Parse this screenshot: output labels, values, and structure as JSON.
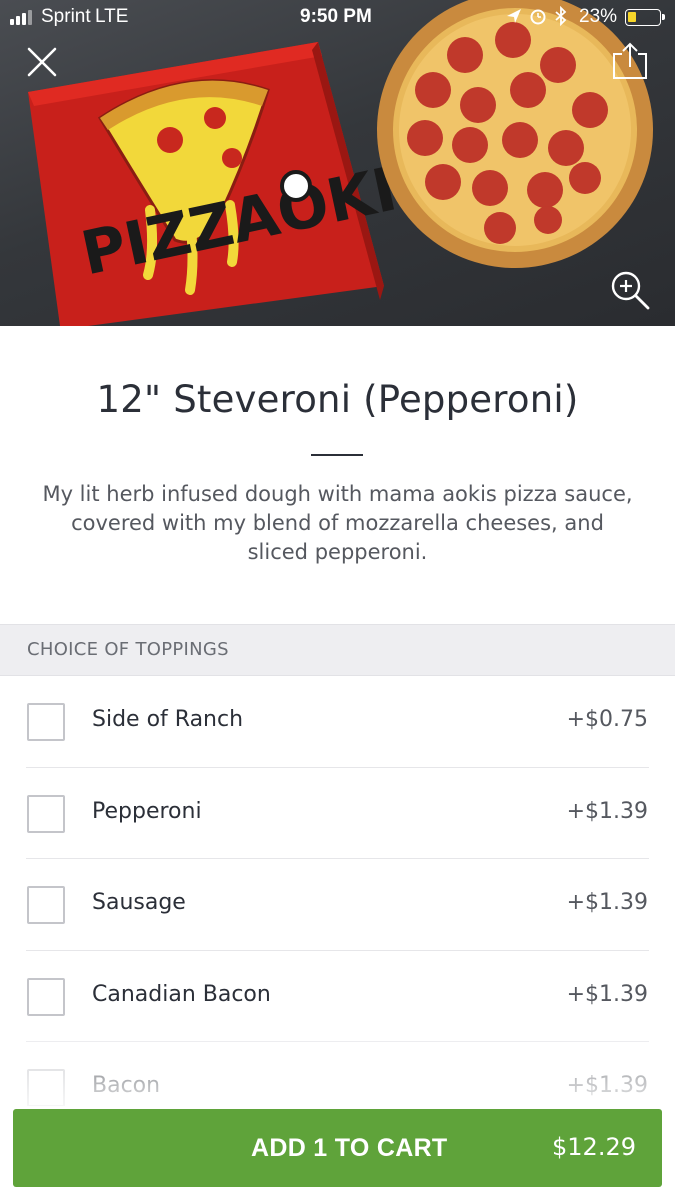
{
  "status_bar": {
    "carrier": "Sprint",
    "network": "LTE",
    "time": "9:50 PM",
    "icons": [
      "location-icon",
      "alarm-icon",
      "bluetooth-icon"
    ],
    "battery_percent": "23%",
    "battery_level": 0.23
  },
  "hero": {
    "image_description": "Red pizza box with yellow pizza-slice logo next to a pepperoni pizza on a dark stone surface",
    "box_logo_text": "PIZZAOKI",
    "close_icon": "close-icon",
    "share_icon": "share-icon",
    "zoom_icon": "zoom-in-icon"
  },
  "product": {
    "title": "12\" Steveroni (Pepperoni)",
    "description": "My lit herb infused dough with mama aokis pizza sauce, covered with my blend of mozzarella cheeses, and sliced pepperoni."
  },
  "toppings": {
    "header": "CHOICE OF TOPPINGS",
    "items": [
      {
        "name": "Side of Ranch",
        "price": "+$0.75",
        "checked": false
      },
      {
        "name": "Pepperoni",
        "price": "+$1.39",
        "checked": false
      },
      {
        "name": "Sausage",
        "price": "+$1.39",
        "checked": false
      },
      {
        "name": "Canadian Bacon",
        "price": "+$1.39",
        "checked": false
      },
      {
        "name": "Bacon",
        "price": "+$1.39",
        "checked": false
      }
    ]
  },
  "cart": {
    "label": "ADD 1 TO CART",
    "price": "$12.29"
  },
  "colors": {
    "accent_green": "#5fa33a",
    "text_dark": "#2b2f38",
    "section_bg": "#eeeef1",
    "battery_yellow": "#f7d62a"
  }
}
